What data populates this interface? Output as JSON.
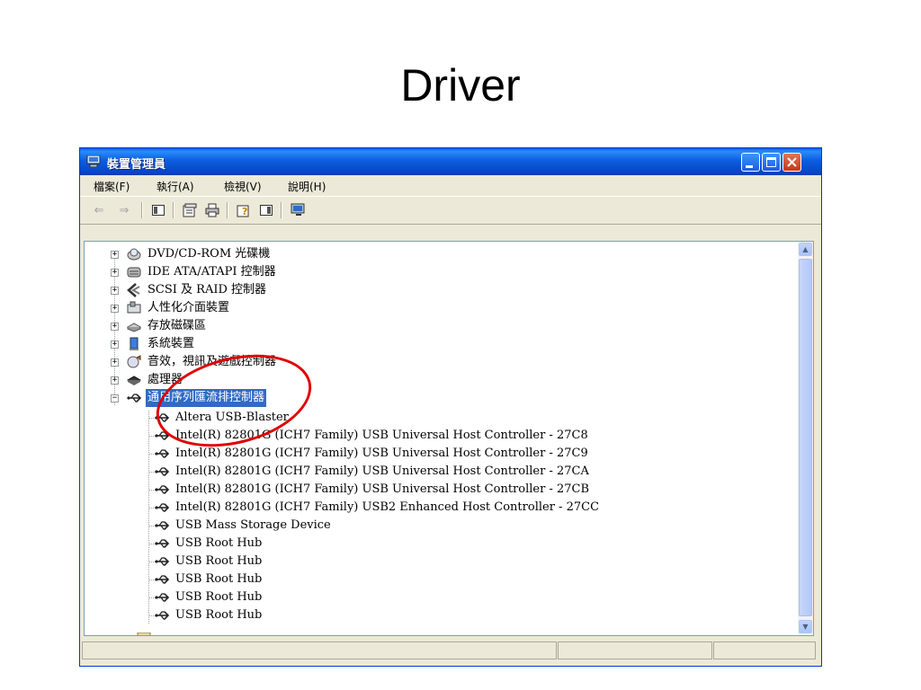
{
  "slide": {
    "title": "Driver"
  },
  "window": {
    "title": "裝置管理員",
    "menu": [
      "檔案(F)",
      "執行(A)",
      "檢視(V)",
      "說明(H)"
    ],
    "toolbar_icons": [
      "back-arrow-icon",
      "forward-arrow-icon",
      "show-hide-icon",
      "properties-icon",
      "print-icon",
      "help-icon",
      "console-tree-icon",
      "scan-hardware-icon"
    ],
    "accent_colors": {
      "titlebar": "#0a5fe4",
      "selection": "#316ac5",
      "annotation": "#e00000"
    }
  },
  "tree": {
    "categories": [
      "DVD/CD-ROM 光碟機",
      "IDE ATA/ATAPI 控制器",
      "SCSI 及 RAID 控制器",
      "人性化介面裝置",
      "存放磁碟區",
      "系統裝置",
      "音效，視訊及遊戲控制器",
      "處理器",
      "通用序列匯流排控制器"
    ],
    "usb_children": [
      "Altera USB-Blaster",
      "Intel(R) 82801G (ICH7 Family) USB Universal Host Controller - 27C8",
      "Intel(R) 82801G (ICH7 Family) USB Universal Host Controller - 27C9",
      "Intel(R) 82801G (ICH7 Family) USB Universal Host Controller - 27CA",
      "Intel(R) 82801G (ICH7 Family) USB Universal Host Controller - 27CB",
      "Intel(R) 82801G (ICH7 Family) USB2 Enhanced Host Controller - 27CC",
      "USB Mass Storage Device",
      "USB Root Hub",
      "USB Root Hub",
      "USB Root Hub",
      "USB Root Hub",
      "USB Root Hub"
    ],
    "expander_collapsed": "+",
    "expander_expanded": "−"
  }
}
